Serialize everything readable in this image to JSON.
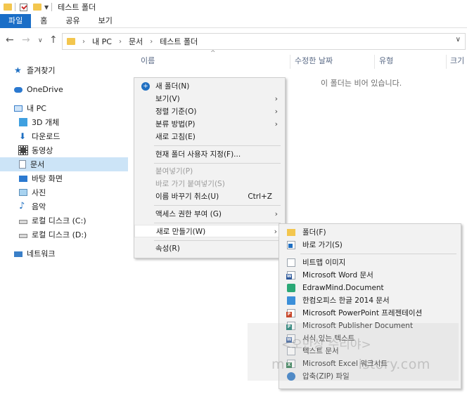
{
  "window": {
    "title": "테스트 폴더"
  },
  "ribbon": {
    "tabs": [
      "파일",
      "홈",
      "공유",
      "보기"
    ]
  },
  "address": {
    "crumbs": [
      "내 PC",
      "문서",
      "테스트 폴더"
    ]
  },
  "nav": {
    "quick_access": "즐겨찾기",
    "onedrive": "OneDrive",
    "this_pc": "내 PC",
    "items": [
      "3D 개체",
      "다운로드",
      "동영상",
      "문서",
      "바탕 화면",
      "사진",
      "음악",
      "로컬 디스크 (C:)",
      "로컬 디스크 (D:)"
    ],
    "network": "네트워크"
  },
  "columns": {
    "name": "이름",
    "date": "수정한 날짜",
    "type": "유형",
    "size": "크기"
  },
  "empty_message": "이 폴더는 비어 있습니다.",
  "context_menu": {
    "new_folder": "새 폴더(N)",
    "view": "보기(V)",
    "sort": "정렬 기준(O)",
    "group": "분류 방법(P)",
    "refresh": "새로 고침(E)",
    "customize": "현재 폴더 사용자 지정(F)...",
    "paste": "붙여넣기(P)",
    "paste_shortcut": "바로 가기 붙여넣기(S)",
    "undo_rename": "이름 바꾸기 취소(U)",
    "undo_accel": "Ctrl+Z",
    "give_access": "액세스 권한 부여 (G)",
    "new": "새로 만들기(W)",
    "properties": "속성(R)"
  },
  "submenu": {
    "folder": "폴더(F)",
    "shortcut": "바로 가기(S)",
    "bitmap": "비트맵 이미지",
    "word": "Microsoft Word 문서",
    "edrawmind": "EdrawMind.Document",
    "hancom": "한컴오피스 한글 2014 문서",
    "powerpoint": "Microsoft PowerPoint 프레젠테이션",
    "publisher": "Microsoft Publisher Document",
    "rtf": "서식 있는 텍스트",
    "text": "텍스트 문서",
    "excel": "Microsoft Excel 워크시트",
    "zip": "압축(ZIP) 파일"
  },
  "watermark": {
    "line1": "<오만상 수리야>",
    "line2": "m                istory.com"
  },
  "colors": {
    "accent": "#1a6ec7",
    "selection": "#cce4f7",
    "folder": "#f3c64e"
  }
}
